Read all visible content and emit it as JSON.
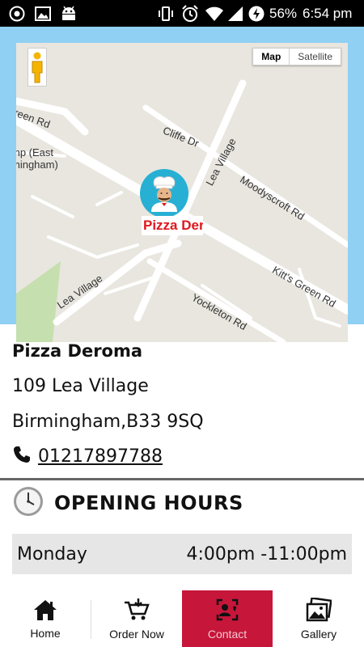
{
  "status_bar": {
    "battery": "56%",
    "time": "6:54 pm",
    "icons": [
      "app-circle-icon",
      "image-icon",
      "android-icon",
      "vibrate-icon",
      "alarm-icon",
      "wifi-icon",
      "signal-icon",
      "battery-charging-icon"
    ]
  },
  "map": {
    "map_toggle_label": "Map",
    "satellite_toggle_label": "Satellite",
    "marker_label": "Pizza Deroma",
    "roads": [
      "reen Rd",
      "mp (East",
      "mingham)",
      "Cliffe Dr",
      "Lea Village",
      "Moodyscroft Rd",
      "Lea Village",
      "Kitt's Green Rd",
      "Yockleton Rd"
    ],
    "colors": {
      "frame": "#8fd0f3",
      "land": "#e8e6df",
      "road": "#ffffff",
      "park": "#c6dfae",
      "marker": "#27b0d4",
      "marker_text": "#e0161e"
    }
  },
  "contact": {
    "name": "Pizza Deroma",
    "address_line1": "109 Lea Village",
    "address_line2": "Birmingham,B33 9SQ",
    "phone": "01217897788"
  },
  "hours": {
    "title": "OPENING HOURS",
    "rows": [
      {
        "day": "Monday",
        "time": "4:00pm -11:00pm"
      }
    ]
  },
  "nav": {
    "items": [
      {
        "label": "Home",
        "icon": "home-icon"
      },
      {
        "label": "Order Now",
        "icon": "cart-icon"
      },
      {
        "label": "Contact",
        "icon": "contact-icon",
        "active": true
      },
      {
        "label": "Gallery",
        "icon": "gallery-icon"
      }
    ],
    "active_color": "#c6163a"
  }
}
